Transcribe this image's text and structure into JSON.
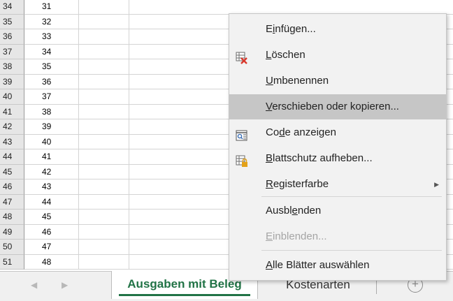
{
  "rows": [
    {
      "header": "34",
      "value": "31"
    },
    {
      "header": "35",
      "value": "32"
    },
    {
      "header": "36",
      "value": "33"
    },
    {
      "header": "37",
      "value": "34"
    },
    {
      "header": "38",
      "value": "35"
    },
    {
      "header": "39",
      "value": "36"
    },
    {
      "header": "40",
      "value": "37"
    },
    {
      "header": "41",
      "value": "38"
    },
    {
      "header": "42",
      "value": "39"
    },
    {
      "header": "43",
      "value": "40"
    },
    {
      "header": "44",
      "value": "41"
    },
    {
      "header": "45",
      "value": "42"
    },
    {
      "header": "46",
      "value": "43"
    },
    {
      "header": "47",
      "value": "44"
    },
    {
      "header": "48",
      "value": "45"
    },
    {
      "header": "49",
      "value": "46"
    },
    {
      "header": "50",
      "value": "47"
    },
    {
      "header": "51",
      "value": "48"
    }
  ],
  "tabs": {
    "active": "Ausgaben mit Beleg",
    "second": "Kostenarten",
    "add_symbol": "+",
    "prev_arrow": "◀",
    "next_arrow": "▶"
  },
  "context_menu": {
    "items": [
      {
        "pre": "E",
        "key": "i",
        "post": "nfügen...",
        "icon": "",
        "state": "normal"
      },
      {
        "pre": "",
        "key": "L",
        "post": "öschen",
        "icon": "delete-sheet-icon",
        "state": "normal"
      },
      {
        "pre": "",
        "key": "U",
        "post": "mbenennen",
        "icon": "",
        "state": "normal"
      },
      {
        "pre": "",
        "key": "V",
        "post": "erschieben oder kopieren...",
        "icon": "",
        "state": "highlighted"
      },
      {
        "pre": "Co",
        "key": "d",
        "post": "e anzeigen",
        "icon": "view-code-icon",
        "state": "normal"
      },
      {
        "pre": "",
        "key": "B",
        "post": "lattschutz aufheben...",
        "icon": "unprotect-sheet-icon",
        "state": "normal"
      },
      {
        "pre": "",
        "key": "R",
        "post": "egisterfarbe",
        "icon": "",
        "state": "normal",
        "submenu_arrow": "▶"
      },
      {
        "pre": "Ausbl",
        "key": "e",
        "post": "nden",
        "icon": "",
        "state": "normal"
      },
      {
        "pre": "",
        "key": "E",
        "post": "inblenden...",
        "icon": "",
        "state": "disabled"
      },
      {
        "pre": "",
        "key": "A",
        "post": "lle Blätter auswählen",
        "icon": "",
        "state": "normal"
      }
    ]
  },
  "colors": {
    "excel_green": "#217346",
    "menu_bg": "#f2f2f2",
    "menu_highlight": "#c6c6c6",
    "delete_red": "#d9382c",
    "lock_gold": "#e3a21a"
  }
}
